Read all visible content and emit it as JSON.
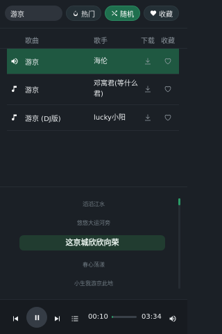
{
  "search": {
    "value": "游京",
    "placeholder": ""
  },
  "filters": [
    {
      "label": "热门",
      "icon": "fire-icon",
      "active": false
    },
    {
      "label": "随机",
      "icon": "shuffle-icon",
      "active": true
    },
    {
      "label": "收藏",
      "icon": "heart-icon",
      "active": false
    }
  ],
  "table": {
    "headers": {
      "song": "歌曲",
      "artist": "歌手",
      "download": "下载",
      "favorite": "收藏"
    },
    "rows": [
      {
        "song": "游京",
        "artist": "海伦",
        "playing": true
      },
      {
        "song": "游京",
        "artist": "邓寓君(等什么君)",
        "playing": false
      },
      {
        "song": "游京 (DJ版)",
        "artist": "lucky小阳",
        "playing": false
      }
    ]
  },
  "lyrics": {
    "lines": [
      "滔滔江水",
      "悠悠大运河旁",
      "这京城欣欣向荣",
      "春心荡漾",
      "小生我游京此地"
    ],
    "current_index": 2
  },
  "player": {
    "current_time": "00:10",
    "total_time": "03:34",
    "progress": 0.05
  },
  "colors": {
    "accent": "#2b9a66",
    "active_row": "#1f5841",
    "background": "#1b2026"
  }
}
